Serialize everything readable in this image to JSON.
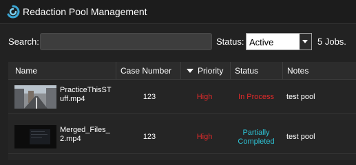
{
  "window": {
    "title": "Redaction Pool Management"
  },
  "filters": {
    "search_label": "Search:",
    "search_value": "",
    "search_placeholder": "",
    "status_label": "Status:",
    "status_selected": "Active",
    "jobs_count": "5 Jobs."
  },
  "table": {
    "columns": [
      "Name",
      "Case Number",
      "Priority",
      "Status",
      "Notes"
    ],
    "sorted_column": "Priority",
    "sort_direction": "descending",
    "rows": [
      {
        "name": "PracticeThisSTuff.mp4",
        "case_number": "123",
        "priority": "High",
        "status": "In Process",
        "notes": "test pool"
      },
      {
        "name": "Merged_Files_2.mp4",
        "case_number": "123",
        "priority": "High",
        "status": "Partially Completed",
        "notes": "test pool"
      }
    ]
  },
  "colors": {
    "priority_high": "#e02a2a",
    "status_in_process": "#e02a2a",
    "status_partially_completed": "#2ec4d6",
    "background": "#222222"
  }
}
